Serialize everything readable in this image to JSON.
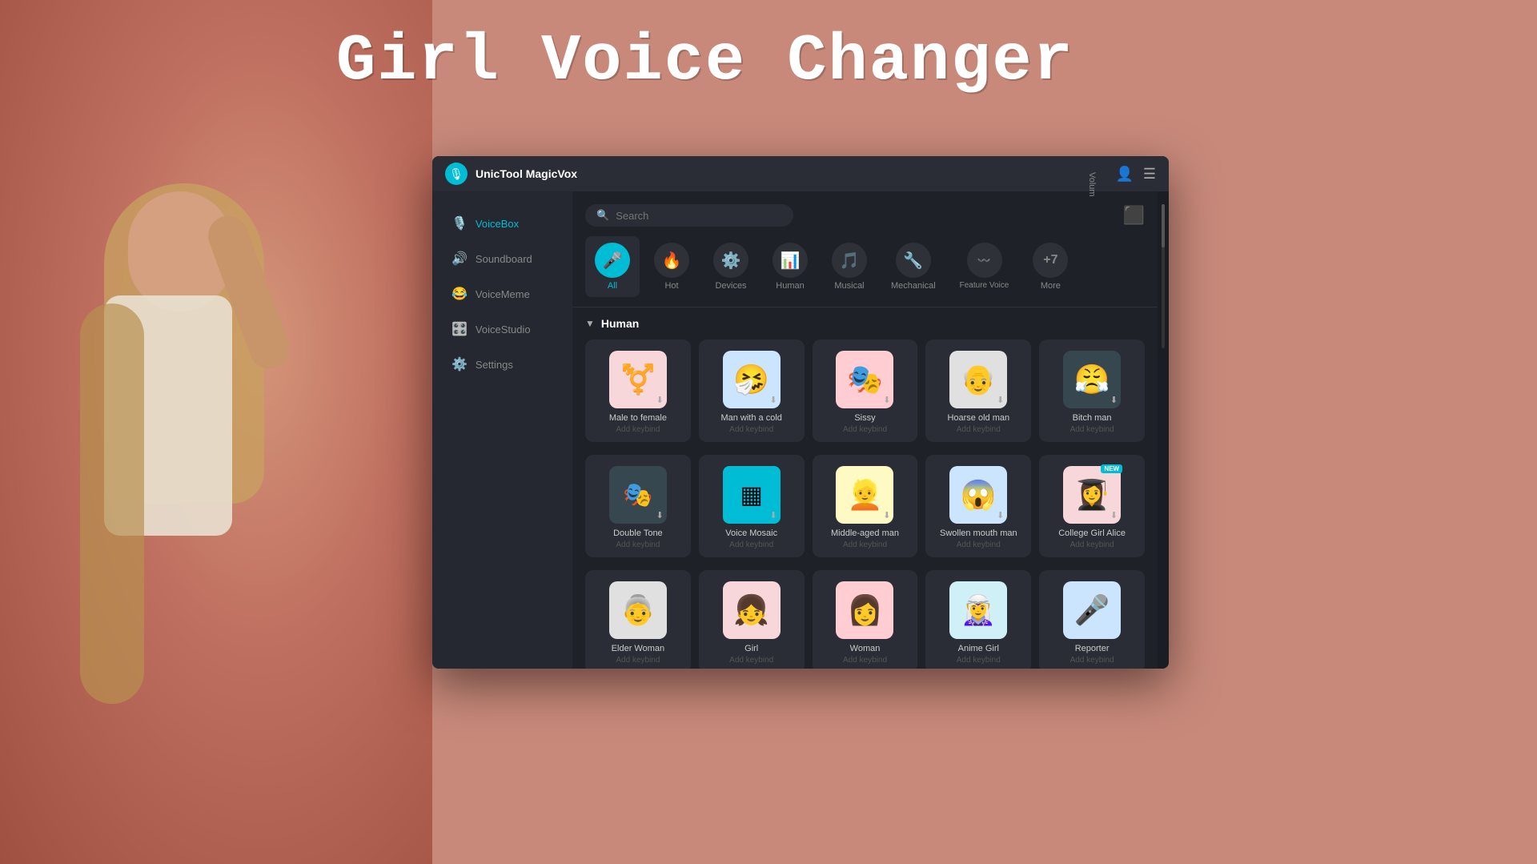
{
  "page": {
    "title": "Girl Voice Changer",
    "background_color": "#c8897a"
  },
  "app": {
    "title": "UnicTool MagicVox",
    "search_placeholder": "Search"
  },
  "sidebar": {
    "items": [
      {
        "id": "voicebox",
        "label": "VoiceBox",
        "icon": "🎙️",
        "active": true
      },
      {
        "id": "soundboard",
        "label": "Soundboard",
        "icon": "🔊",
        "active": false
      },
      {
        "id": "voicememe",
        "label": "VoiceMeme",
        "icon": "😂",
        "active": false
      },
      {
        "id": "voicestudio",
        "label": "VoiceStudio",
        "icon": "🎛️",
        "active": false
      },
      {
        "id": "settings",
        "label": "Settings",
        "icon": "⚙️",
        "active": false
      }
    ]
  },
  "categories": [
    {
      "id": "all",
      "label": "All",
      "icon": "🎤",
      "active": true
    },
    {
      "id": "hot",
      "label": "Hot",
      "icon": "🔥",
      "active": false
    },
    {
      "id": "devices",
      "label": "Devices",
      "icon": "⚙️",
      "active": false
    },
    {
      "id": "human",
      "label": "Human",
      "icon": "📊",
      "active": false
    },
    {
      "id": "musical",
      "label": "Musical",
      "icon": "🎵",
      "active": false
    },
    {
      "id": "mechanical",
      "label": "Mechanical",
      "icon": "🔧",
      "active": false
    },
    {
      "id": "feature_voice",
      "label": "Feature Voice",
      "icon": "〰️",
      "active": false
    },
    {
      "id": "more",
      "label": "More",
      "icon": "+7",
      "active": false
    }
  ],
  "section_human": {
    "label": "Human",
    "voices": [
      {
        "id": "male_to_female",
        "name": "Male to female",
        "keybind": "Add keybind",
        "emoji": "⚧",
        "color": "#f8d7da",
        "download": true
      },
      {
        "id": "man_with_cold",
        "name": "Man with a cold",
        "keybind": "Add keybind",
        "emoji": "🤧",
        "color": "#cce5ff",
        "download": true
      },
      {
        "id": "sissy",
        "name": "Sissy",
        "keybind": "Add keybind",
        "emoji": "🎭",
        "color": "#ffcdd2",
        "download": true
      },
      {
        "id": "hoarse_old_man",
        "name": "Hoarse old man",
        "keybind": "Add keybind",
        "emoji": "👴",
        "color": "#e0e0e0",
        "download": true
      },
      {
        "id": "bitch_man",
        "name": "Bitch man",
        "keybind": "Add keybind",
        "emoji": "😤",
        "color": "#ffcdd2",
        "download": true
      }
    ],
    "voices2": [
      {
        "id": "double_tone",
        "name": "Double Tone",
        "keybind": "Add keybind",
        "emoji": "🎭",
        "color": "#e1bee7",
        "download": true
      },
      {
        "id": "voice_mosaic",
        "name": "Voice Mosaic",
        "keybind": "Add keybind",
        "emoji": "🟦",
        "color": "#00bcd4",
        "download": true
      },
      {
        "id": "middle_aged_man",
        "name": "Middle-aged man",
        "keybind": "Add keybind",
        "emoji": "👱",
        "color": "#ffe0b2",
        "download": true
      },
      {
        "id": "swollen_mouth_man",
        "name": "Swollen mouth man",
        "keybind": "Add keybind",
        "emoji": "😱",
        "color": "#cce5ff",
        "download": true
      },
      {
        "id": "college_girl_alice",
        "name": "College Girl Alice",
        "keybind": "Add keybind",
        "emoji": "👩‍🎓",
        "color": "#f8d7da",
        "download": true,
        "new": true
      }
    ],
    "voices3": [
      {
        "id": "elder_woman",
        "name": "Elder Woman",
        "keybind": "Add keybind",
        "emoji": "👵",
        "color": "#e0e0e0",
        "download": true
      },
      {
        "id": "girl",
        "name": "Girl",
        "keybind": "Add keybind",
        "emoji": "👧",
        "color": "#ffcdd2",
        "download": true
      },
      {
        "id": "woman",
        "name": "Woman",
        "keybind": "Add keybind",
        "emoji": "👩",
        "color": "#f8d7da",
        "download": true
      },
      {
        "id": "anime_girl",
        "name": "Anime Girl",
        "keybind": "Add keybind",
        "emoji": "🧝‍♀️",
        "color": "#e1bee7",
        "download": true
      },
      {
        "id": "reporter",
        "name": "Reporter",
        "keybind": "Add keybind",
        "emoji": "🎤",
        "color": "#cce5ff",
        "download": true
      }
    ]
  },
  "volume": {
    "label": "Volum"
  }
}
